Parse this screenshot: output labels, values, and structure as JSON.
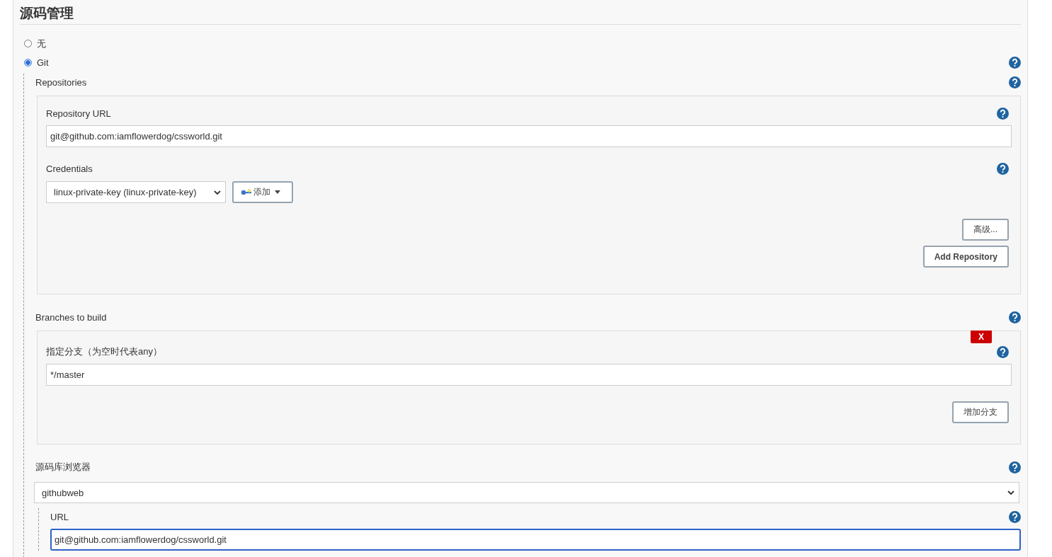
{
  "section": {
    "title": "源码管理"
  },
  "scm_options": [
    {
      "label": "无",
      "selected": false
    },
    {
      "label": "Git",
      "selected": true
    }
  ],
  "repositories": {
    "label": "Repositories",
    "items": [
      {
        "url_label": "Repository URL",
        "url": "git@github.com:iamflowerdog/cssworld.git",
        "credentials_label": "Credentials",
        "credential": "linux-private-key (linux-private-key)",
        "add_button": "添加",
        "advanced_button": "高级..."
      }
    ],
    "add_button": "Add Repository"
  },
  "branches": {
    "label": "Branches to build",
    "items": [
      {
        "delete_button": "X",
        "label": "指定分支（为空时代表any）",
        "value": "*/master"
      }
    ],
    "add_button": "增加分支"
  },
  "browser": {
    "label": "源码库浏览器",
    "value": "githubweb",
    "url_label": "URL",
    "url": "git@github.com:iamflowerdog/cssworld.git",
    "url_focused": true
  }
}
